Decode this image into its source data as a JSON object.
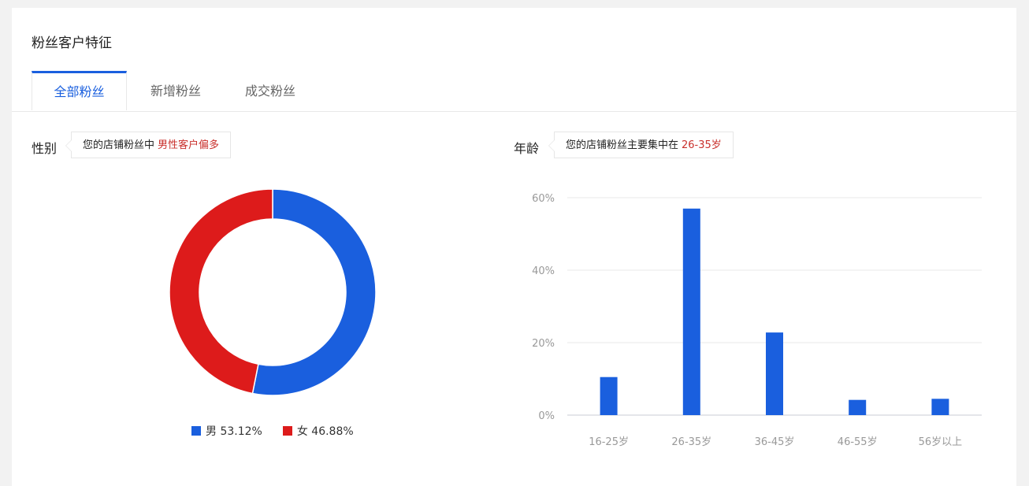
{
  "card": {
    "title": "粉丝客户特征"
  },
  "tabs": [
    {
      "label": "全部粉丝",
      "active": true
    },
    {
      "label": "新增粉丝",
      "active": false
    },
    {
      "label": "成交粉丝",
      "active": false
    }
  ],
  "gender": {
    "label": "性别",
    "tip_prefix": "您的店铺粉丝中",
    "tip_highlight": "男性客户偏多"
  },
  "age": {
    "label": "年龄",
    "tip_prefix": "您的店铺粉丝主要集中在",
    "tip_highlight": "26-35岁"
  },
  "colors": {
    "accent": "#1a5fde",
    "male": "#1a5fde",
    "female": "#dd1b1b",
    "highlight": "#c9302c"
  },
  "chart_data": [
    {
      "type": "pie",
      "donut": true,
      "categories": [
        "男",
        "女"
      ],
      "values": [
        53.12,
        46.88
      ],
      "legend_labels": [
        "男 53.12%",
        "女 46.88%"
      ],
      "colors": [
        "#1a5fde",
        "#dd1b1b"
      ],
      "legend": "bottom"
    },
    {
      "type": "bar",
      "categories": [
        "16-25岁",
        "26-35岁",
        "36-45岁",
        "46-55岁",
        "56岁以上"
      ],
      "values": [
        10.5,
        57,
        22.8,
        4.2,
        4.5
      ],
      "ylim": [
        0,
        60
      ],
      "yticks": [
        0,
        20,
        40,
        60
      ],
      "ytick_labels": [
        "0%",
        "20%",
        "40%",
        "60%"
      ],
      "grid": true,
      "color": "#1a5fde"
    }
  ]
}
